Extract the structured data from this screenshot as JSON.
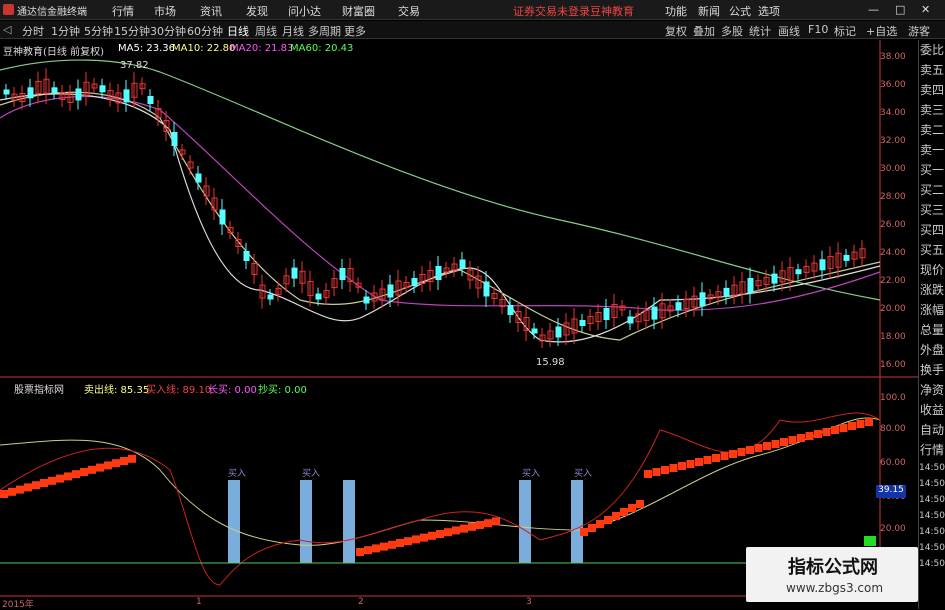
{
  "app": {
    "title": "通达信金融终端",
    "menus": [
      "行情",
      "市场",
      "资讯",
      "发现",
      "问小达",
      "财富圈",
      "交易"
    ],
    "notice": "证券交易未登录",
    "brand": "豆神教育",
    "right": [
      "功能",
      "新闻",
      "公式",
      "选项"
    ],
    "guest": "游客"
  },
  "tabs": {
    "periods": [
      "分时",
      "1分钟",
      "5分钟",
      "15分钟",
      "30分钟",
      "60分钟",
      "日线",
      "周线",
      "月线",
      "多周期",
      "更多"
    ],
    "tools": [
      "复权",
      "叠加",
      "多股",
      "统计",
      "画线",
      "F10",
      "标记",
      "+自选"
    ]
  },
  "chart_header": {
    "name": "豆神教育(日线 前复权)",
    "ma5": "MA5: 23.36",
    "ma10": "MA10: 22.80",
    "ma20": "MA20: 21.83",
    "ma60": "MA60: 20.43"
  },
  "price_axis": [
    "38.00",
    "36.00",
    "34.00",
    "32.00",
    "30.00",
    "28.00",
    "26.00",
    "24.00",
    "22.00",
    "20.00",
    "18.00",
    "16.00"
  ],
  "annotations": {
    "high": "37.82",
    "low": "15.98"
  },
  "indicator": {
    "name": "股票指标网",
    "sell": "卖出线: 85.35",
    "buy": "买入线: 89.10",
    "long": "长买: 0.00",
    "chao": "抄买: 0.00",
    "signals": [
      "买入",
      "买入",
      "买入",
      "买入"
    ],
    "value": "39.15"
  },
  "ind_axis": [
    "100.0",
    "80.00",
    "60.00",
    "40.00",
    "20.00"
  ],
  "date_labels": [
    "2015年",
    "1",
    "2",
    "3"
  ],
  "side_labels": [
    "委比",
    "卖五",
    "卖四",
    "卖三",
    "卖二",
    "卖一",
    "买一",
    "买二",
    "买三",
    "买四",
    "买五",
    "现价",
    "涨跌",
    "涨幅",
    "总量",
    "外盘",
    "换手",
    "净资",
    "收益",
    "自动",
    "行情"
  ],
  "time_labels": [
    "14:50",
    "14:50",
    "14:50",
    "14:50",
    "14:50",
    "14:50",
    "14:50"
  ],
  "watermark": {
    "title": "指标公式网",
    "url": "www.zbgs3.com"
  },
  "colors": {
    "up": "#ff3c3c",
    "down": "#54ffff",
    "ma5": "#ffffff",
    "ma10": "#ffff80",
    "ma20": "#ff50ff",
    "ma60": "#50ff50"
  }
}
